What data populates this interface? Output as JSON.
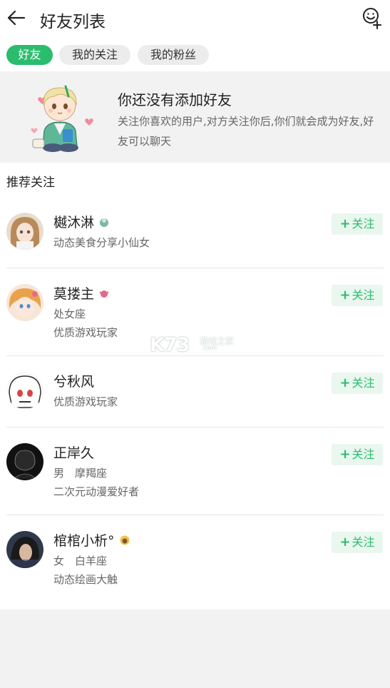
{
  "header": {
    "title": "好友列表",
    "back_icon": "back-arrow-icon",
    "action_icon": "add-friend-icon"
  },
  "tabs": [
    {
      "label": "好友",
      "active": true
    },
    {
      "label": "我的关注",
      "active": false
    },
    {
      "label": "我的粉丝",
      "active": false
    }
  ],
  "empty_state": {
    "title": "你还没有添加好友",
    "description": "关注你喜欢的用户,对方关注你后,你们就会成为好友,好友可以聊天"
  },
  "recommend": {
    "title": "推荐关注",
    "follow_label": "关注",
    "users": [
      {
        "name": "樾沐淋",
        "lines": [
          "动态美食分享小仙女"
        ]
      },
      {
        "name": "莫搂主",
        "lines": [
          "处女座",
          "优质游戏玩家"
        ]
      },
      {
        "name": "兮秋风",
        "lines": [
          "优质游戏玩家"
        ]
      },
      {
        "name": "正岸久",
        "lines": [
          "男　摩羯座",
          "二次元动漫爱好者"
        ]
      },
      {
        "name": "棺棺小析°",
        "lines": [
          "女　白羊座",
          "动态绘画大触"
        ]
      }
    ]
  },
  "watermark": {
    "big": "K73",
    "small": "游戏之家",
    "url": ".com"
  },
  "colors": {
    "accent": "#2bbd6e",
    "follow_bg": "#e9f7ef"
  }
}
